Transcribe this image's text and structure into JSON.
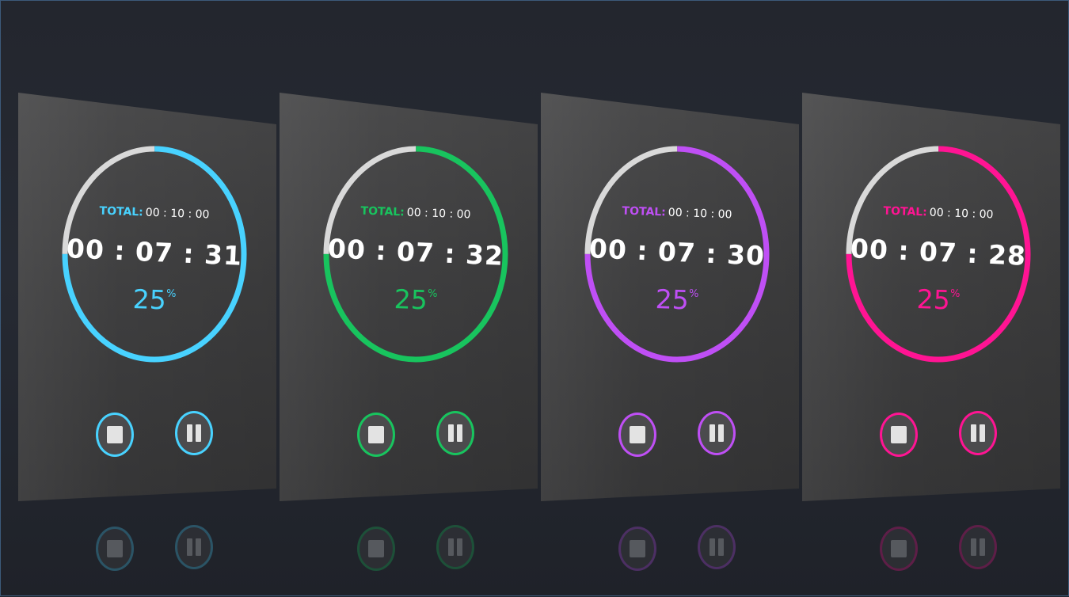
{
  "timers": [
    {
      "total_label": "TOTAL:",
      "total_value": "00 : 10 : 00",
      "elapsed": "00 : 07 : 31",
      "percent_value": "25",
      "percent_sign": "%",
      "progress": 0.25,
      "accent_color": "#48d2ff",
      "track_color": "#d9d9d9",
      "stop_icon": "stop-icon",
      "pause_icon": "pause-icon"
    },
    {
      "total_label": "TOTAL:",
      "total_value": "00 : 10 : 00",
      "elapsed": "00 : 07 : 32",
      "percent_value": "25",
      "percent_sign": "%",
      "progress": 0.25,
      "accent_color": "#18c45e",
      "track_color": "#d9d9d9",
      "stop_icon": "stop-icon",
      "pause_icon": "pause-icon"
    },
    {
      "total_label": "TOTAL:",
      "total_value": "00 : 10 : 00",
      "elapsed": "00 : 07 : 30",
      "percent_value": "25",
      "percent_sign": "%",
      "progress": 0.25,
      "accent_color": "#bf4ff5",
      "track_color": "#d9d9d9",
      "stop_icon": "stop-icon",
      "pause_icon": "pause-icon"
    },
    {
      "total_label": "TOTAL:",
      "total_value": "00 : 10 : 00",
      "elapsed": "00 : 07 : 28",
      "percent_value": "25",
      "percent_sign": "%",
      "progress": 0.25,
      "accent_color": "#ff1493",
      "track_color": "#d9d9d9",
      "stop_icon": "stop-icon",
      "pause_icon": "pause-icon"
    }
  ]
}
